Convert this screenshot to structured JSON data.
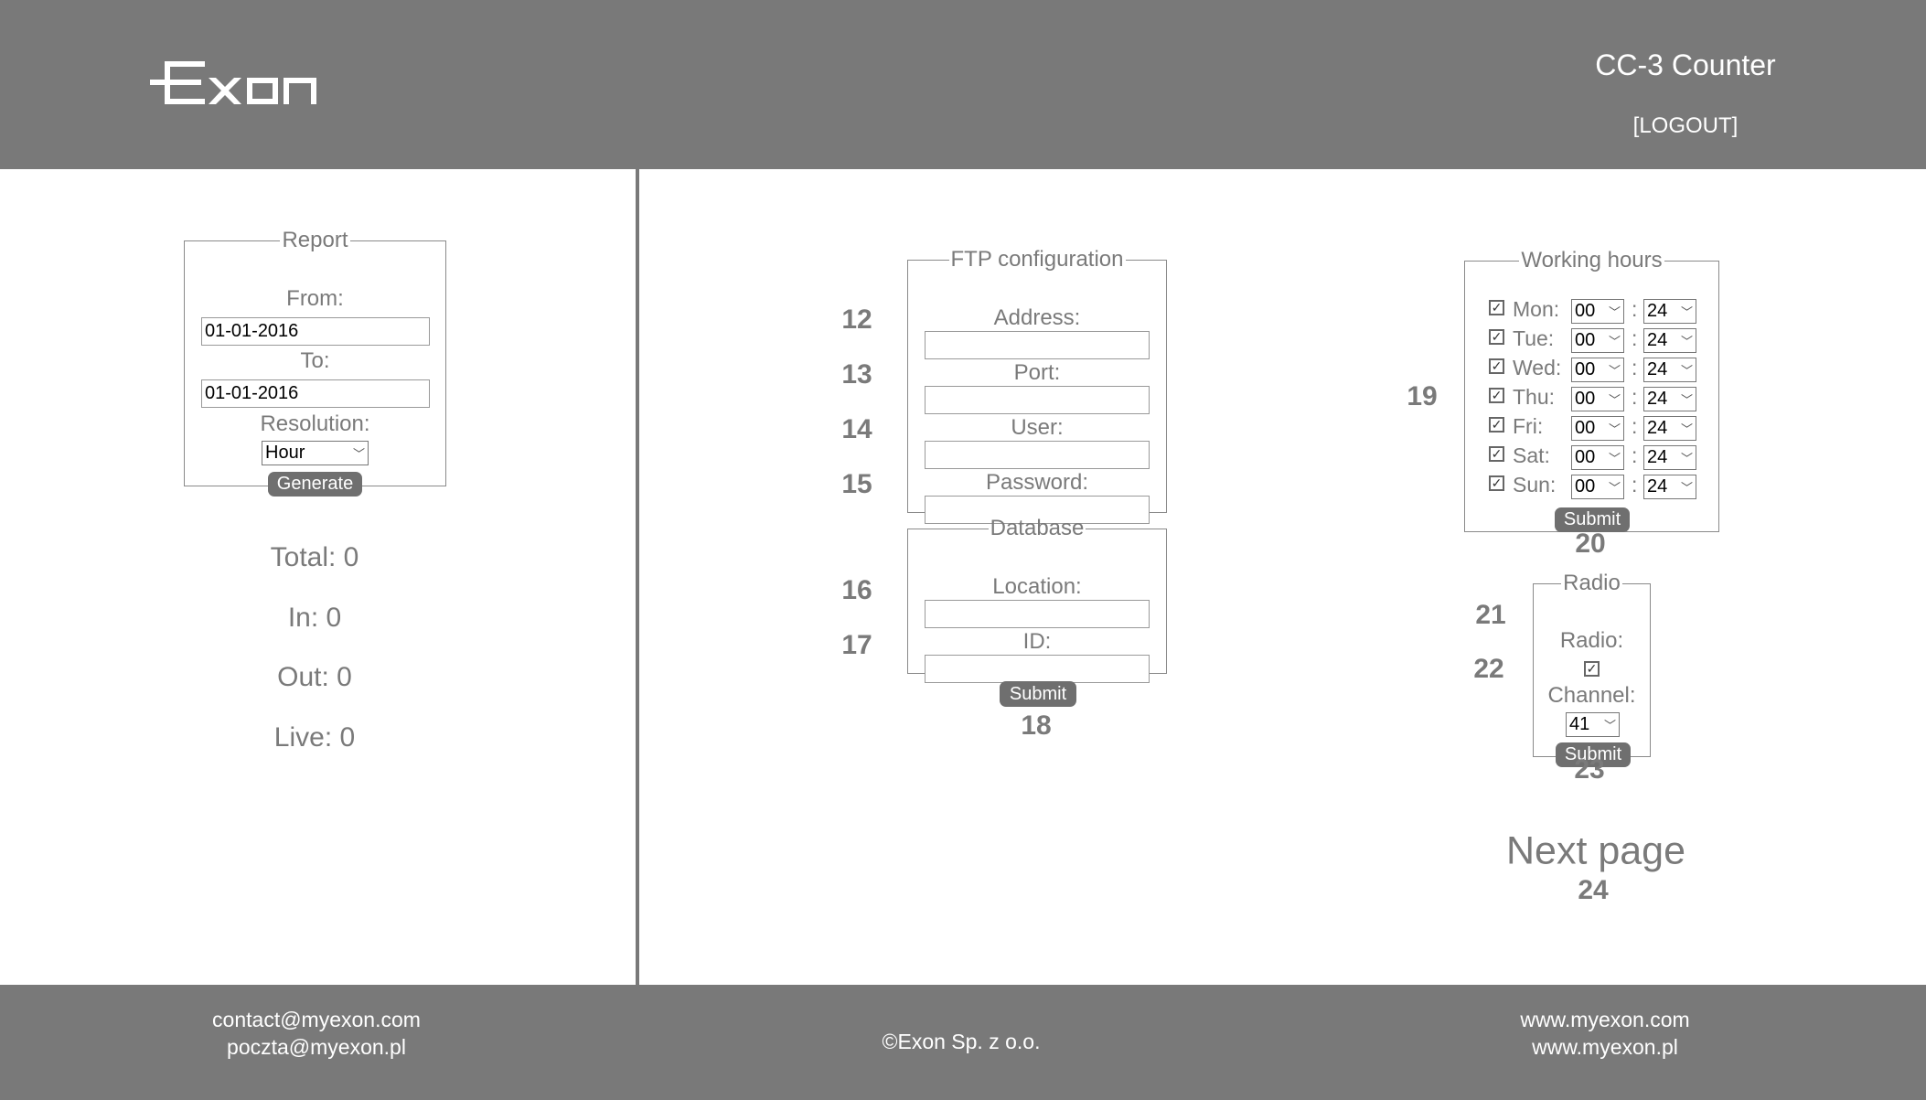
{
  "header": {
    "logo": "Exon",
    "title": "CC-3 Counter",
    "logout": "[LOGOUT]"
  },
  "report": {
    "legend": "Report",
    "from_label": "From:",
    "from_value": "01-01-2016",
    "to_label": "To:",
    "to_value": "01-01-2016",
    "resolution_label": "Resolution:",
    "resolution_value": "Hour",
    "generate": "Generate"
  },
  "stats": {
    "total": "Total: 0",
    "in": "In: 0",
    "out": "Out: 0",
    "live": "Live: 0"
  },
  "ftp": {
    "legend": "FTP configuration",
    "address": "Address:",
    "port": "Port:",
    "user": "User:",
    "password": "Password:"
  },
  "database": {
    "legend": "Database",
    "location": "Location:",
    "id": "ID:",
    "submit": "Submit"
  },
  "numbers": {
    "n12": "12",
    "n13": "13",
    "n14": "14",
    "n15": "15",
    "n16": "16",
    "n17": "17",
    "n18": "18",
    "n19": "19",
    "n20": "20",
    "n21": "21",
    "n22": "22",
    "n23": "23",
    "n24": "24"
  },
  "working_hours": {
    "legend": "Working hours",
    "separator": ":",
    "submit": "Submit",
    "days": [
      {
        "label": "Mon:",
        "checked": true,
        "from": "00",
        "to": "24"
      },
      {
        "label": "Tue:",
        "checked": true,
        "from": "00",
        "to": "24"
      },
      {
        "label": "Wed:",
        "checked": true,
        "from": "00",
        "to": "24"
      },
      {
        "label": "Thu:",
        "checked": true,
        "from": "00",
        "to": "24"
      },
      {
        "label": "Fri:",
        "checked": true,
        "from": "00",
        "to": "24"
      },
      {
        "label": "Sat:",
        "checked": true,
        "from": "00",
        "to": "24"
      },
      {
        "label": "Sun:",
        "checked": true,
        "from": "00",
        "to": "24"
      }
    ]
  },
  "radio": {
    "legend": "Radio",
    "radio_label": "Radio:",
    "radio_checked": true,
    "channel_label": "Channel:",
    "channel_value": "41",
    "submit": "Submit"
  },
  "next_page": "Next page",
  "footer": {
    "email1": "contact@myexon.com",
    "email2": "poczta@myexon.pl",
    "copyright": "©Exon Sp. z o.o.",
    "web1": "www.myexon.com",
    "web2": "www.myexon.pl"
  }
}
